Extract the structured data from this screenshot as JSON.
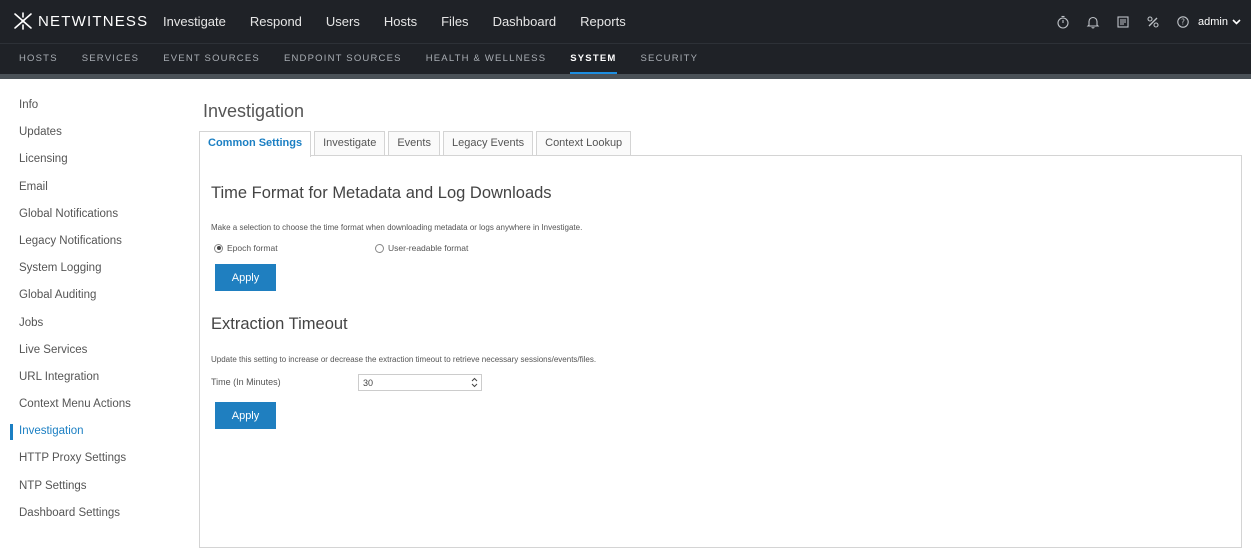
{
  "app": {
    "brand": "NETWITNESS"
  },
  "main_nav": [
    "Investigate",
    "Respond",
    "Users",
    "Hosts",
    "Files",
    "Dashboard",
    "Reports"
  ],
  "header_icons": [
    "timer-icon",
    "bell-icon",
    "notes-icon",
    "tools-icon",
    "help-icon"
  ],
  "user": {
    "name": "admin"
  },
  "sub_nav": [
    {
      "label": "HOSTS",
      "active": false
    },
    {
      "label": "SERVICES",
      "active": false
    },
    {
      "label": "EVENT SOURCES",
      "active": false
    },
    {
      "label": "ENDPOINT SOURCES",
      "active": false
    },
    {
      "label": "HEALTH & WELLNESS",
      "active": false
    },
    {
      "label": "SYSTEM",
      "active": true
    },
    {
      "label": "SECURITY",
      "active": false
    }
  ],
  "sidebar": {
    "items": [
      "Info",
      "Updates",
      "Licensing",
      "Email",
      "Global Notifications",
      "Legacy Notifications",
      "System Logging",
      "Global Auditing",
      "Jobs",
      "Live Services",
      "URL Integration",
      "Context Menu Actions",
      "Investigation",
      "HTTP Proxy Settings",
      "NTP Settings",
      "Dashboard Settings"
    ],
    "active": "Investigation"
  },
  "page": {
    "title": "Investigation",
    "tabs": [
      "Common Settings",
      "Investigate",
      "Events",
      "Legacy Events",
      "Context Lookup"
    ],
    "active_tab": "Common Settings"
  },
  "time_format": {
    "title": "Time Format for Metadata and Log Downloads",
    "description": "Make a selection to choose the time format when downloading metadata or logs anywhere in Investigate.",
    "options": [
      "Epoch format",
      "User-readable format"
    ],
    "selected": "Epoch format",
    "apply_label": "Apply"
  },
  "extraction": {
    "title": "Extraction Timeout",
    "description": "Update this setting to increase or decrease the extraction timeout to retrieve necessary sessions/events/files.",
    "field_label": "Time (In Minutes)",
    "value": "30",
    "apply_label": "Apply"
  },
  "colors": {
    "topbar": "#1f2227",
    "accent": "#1b7fc3",
    "button": "#1f7fc0"
  }
}
